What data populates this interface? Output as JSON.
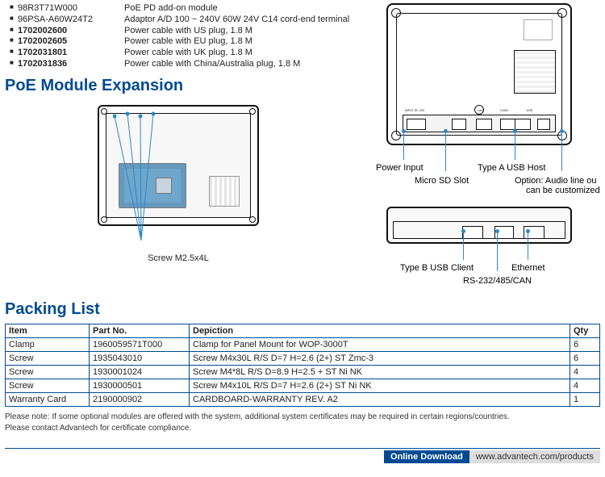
{
  "accessories": [
    {
      "sku": "98R3T71W000",
      "bold": false,
      "desc": "PoE PD add-on module"
    },
    {
      "sku": "96PSA-A60W24T2",
      "bold": false,
      "desc": "Adaptor A/D 100 ~ 240V 60W 24V C14 cord-end terminal"
    },
    {
      "sku": "1702002600",
      "bold": true,
      "desc": "Power cable with US plug, 1.8 M"
    },
    {
      "sku": "1702002605",
      "bold": true,
      "desc": "Power cable with EU plug, 1.8 M"
    },
    {
      "sku": "1702031801",
      "bold": true,
      "desc": "Power cable with UK plug, 1.8 M"
    },
    {
      "sku": "1702031836",
      "bold": true,
      "desc": "Power cable with China/Australia plug, 1.8 M"
    }
  ],
  "sections": {
    "poe_title": "PoE Module Expansion",
    "packing_title": "Packing List",
    "poe_screw_callout": "Screw M2.5x4L"
  },
  "rear_diagram": {
    "strip_labels": {
      "input": "INPUT DC 24V",
      "lan": "LAN",
      "com": "COM1",
      "usb": "USB"
    },
    "captions": {
      "power_input": "Power Input",
      "usb_host": "Type A USB Host",
      "micro_sd": "Micro SD Slot",
      "audio_opt_l1": "Option: Audio line ou",
      "audio_opt_l2": "can be customized"
    }
  },
  "front_diagram": {
    "captions": {
      "usb_client": "Type B USB Client",
      "ethernet": "Ethernet",
      "serial": "RS-232/485/CAN"
    }
  },
  "packing": {
    "headers": {
      "item": "Item",
      "partno": "Part No.",
      "depiction": "Depiction",
      "qty": "Qty"
    },
    "rows": [
      {
        "item": "Clamp",
        "partno": "1960059571T000",
        "depiction": "Clamp for Panel Mount for WOP-3000T",
        "qty": "6"
      },
      {
        "item": "Screw",
        "partno": "1935043010",
        "depiction": "Screw M4x30L R/S D=7 H=2.6 (2+) ST Zmc-3",
        "qty": "6"
      },
      {
        "item": "Screw",
        "partno": "1930001024",
        "depiction": "Screw M4*8L R/S D=8.9 H=2.5 + ST Ni NK",
        "qty": "4"
      },
      {
        "item": "Screw",
        "partno": "1930000501",
        "depiction": "Screw M4x10L R/S D=7 H=2.6 (2+) ST Ni NK",
        "qty": "4"
      },
      {
        "item": "Warranty Card",
        "partno": "2190000902",
        "depiction": "CARDBOARD-WARRANTY REV. A2",
        "qty": "1"
      }
    ]
  },
  "note": {
    "l1": "Please note: If some optional modules are offered with the system, additional system certificates may be required in certain regions/countries.",
    "l2": "Please contact Advantech for certificate compliance."
  },
  "footer": {
    "label": "Online Download",
    "url": "www.advantech.com/products"
  }
}
